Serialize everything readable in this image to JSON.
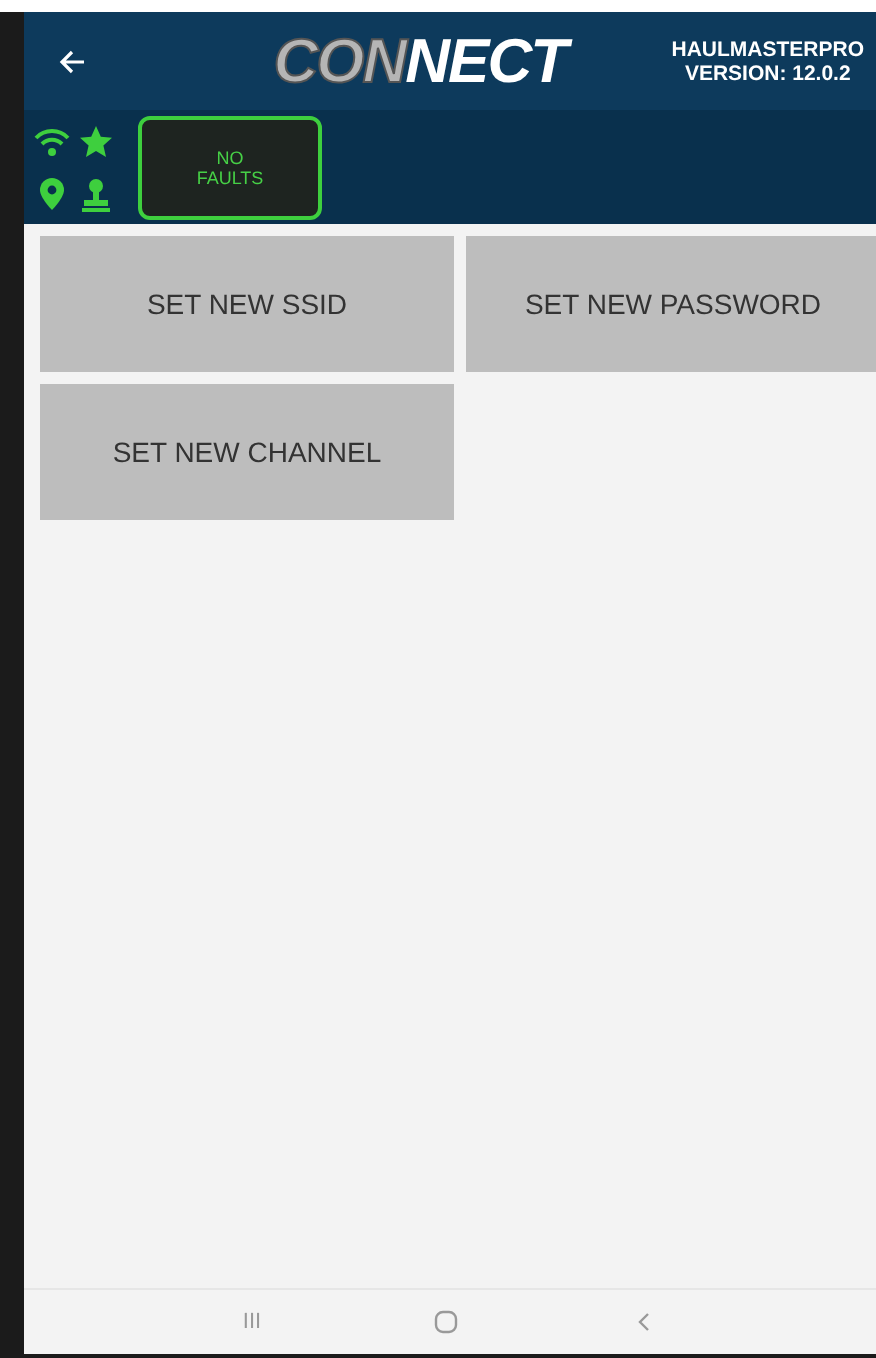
{
  "header": {
    "logo": {
      "part_1": "CON",
      "part_2": "NECT"
    },
    "app_name": "HAULMASTERPRO",
    "version": "VERSION: 12.0.2"
  },
  "status": {
    "faults": {
      "line_1": "NO",
      "line_2": "FAULTS"
    }
  },
  "buttons": [
    {
      "label": "SET NEW SSID"
    },
    {
      "label": "SET NEW PASSWORD"
    },
    {
      "label": "SET NEW CHANNEL"
    }
  ],
  "nav_bar": {
    "recent": "III"
  }
}
